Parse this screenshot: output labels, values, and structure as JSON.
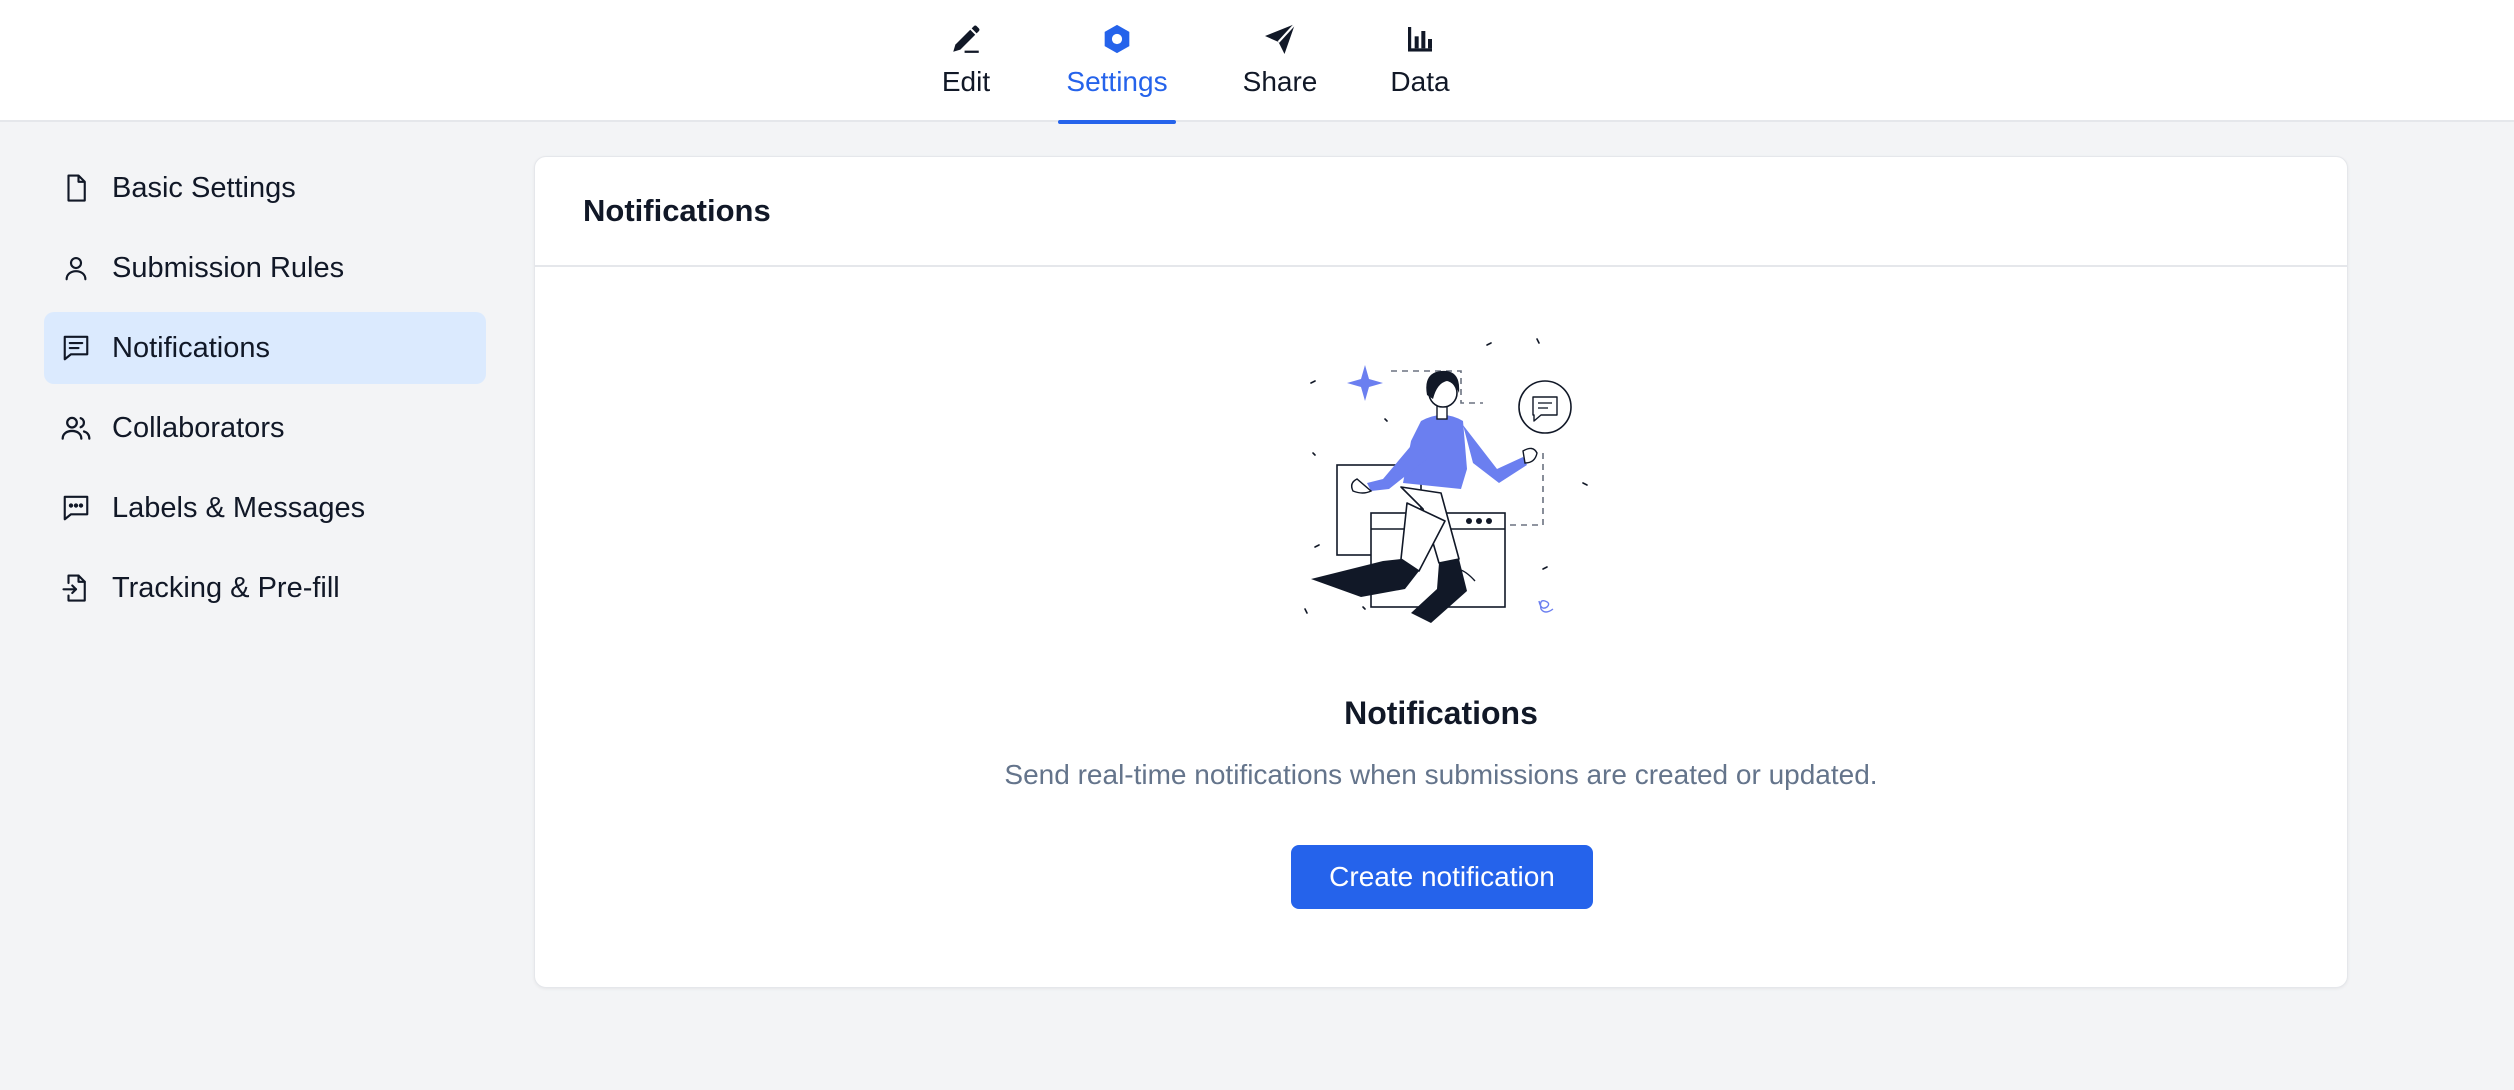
{
  "tabs": [
    {
      "label": "Edit",
      "icon": "pencil-icon",
      "active": false
    },
    {
      "label": "Settings",
      "icon": "hexagon-settings-icon",
      "active": true
    },
    {
      "label": "Share",
      "icon": "paper-plane-icon",
      "active": false
    },
    {
      "label": "Data",
      "icon": "bar-chart-icon",
      "active": false
    }
  ],
  "sidebar": {
    "items": [
      {
        "label": "Basic Settings",
        "icon": "file-icon",
        "active": false
      },
      {
        "label": "Submission Rules",
        "icon": "user-icon",
        "active": false
      },
      {
        "label": "Notifications",
        "icon": "message-square-text-icon",
        "active": true
      },
      {
        "label": "Collaborators",
        "icon": "users-icon",
        "active": false
      },
      {
        "label": "Labels & Messages",
        "icon": "message-dots-icon",
        "active": false
      },
      {
        "label": "Tracking & Pre-fill",
        "icon": "file-import-icon",
        "active": false
      }
    ]
  },
  "panel": {
    "title": "Notifications",
    "empty_state": {
      "illustration": "woman-with-notifications-illustration",
      "title": "Notifications",
      "description": "Send real-time notifications when submissions are created or updated.",
      "button_label": "Create notification"
    }
  },
  "colors": {
    "accent": "#2563eb",
    "active_bg": "#dbeafe",
    "illustration_accent": "#6b7ff0"
  }
}
